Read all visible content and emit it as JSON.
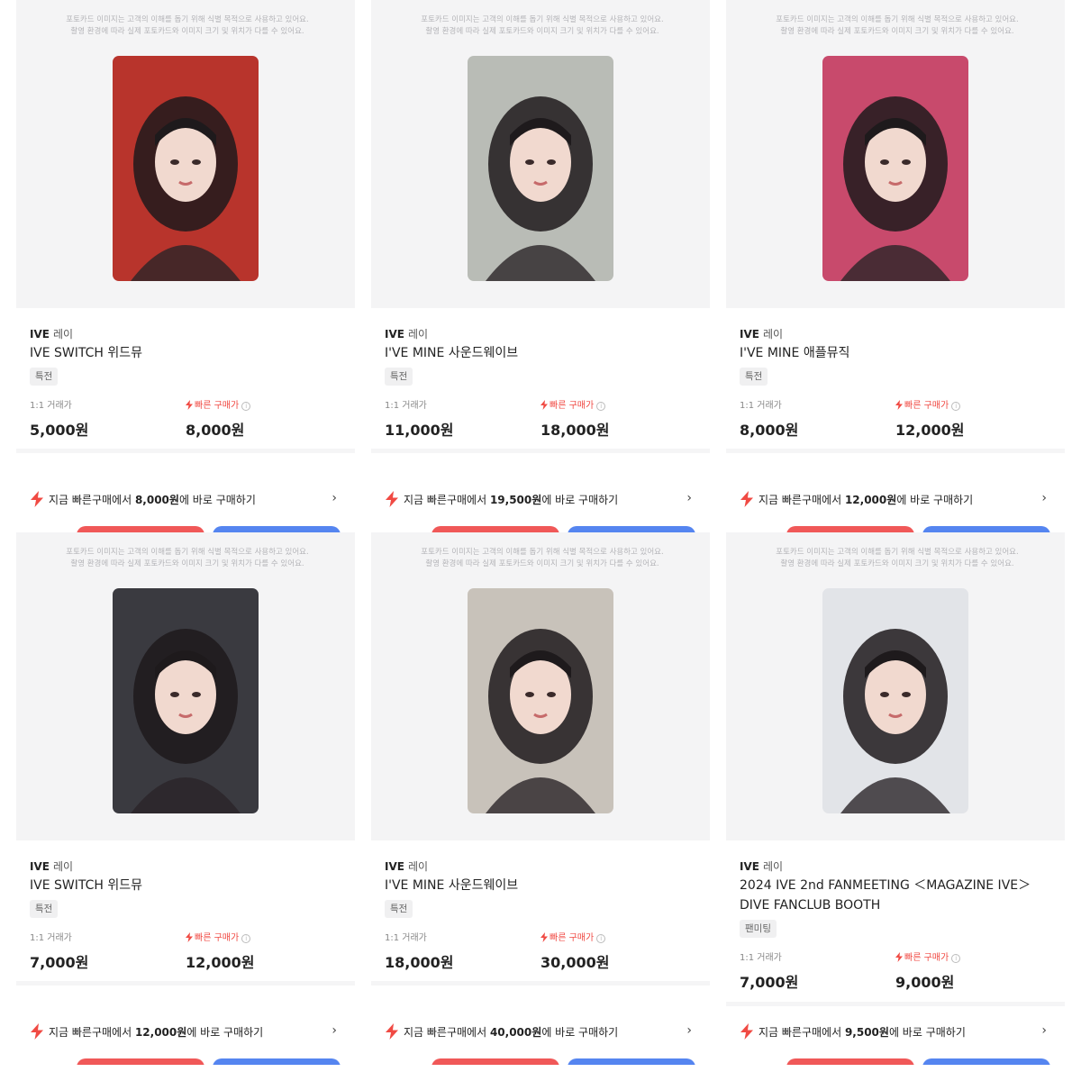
{
  "notice_lines": [
    "포토카드 이미지는 고객의 이해를 돕기 위해 식별 목적으로 사용하고 있어요.",
    "촬영 환경에 따라 실제 포토카드와 이미지 크기 및 위치가 다를 수 있어요."
  ],
  "labels": {
    "trade_label": "1:1 거래가",
    "quick_label": "빠른 구매가",
    "info_icon": "info-icon",
    "bolt_icon": "lightning-icon",
    "chevron_icon": "chevron-right-icon",
    "chevron_glyph": "›"
  },
  "colors": {
    "accent_red": "#f04a43",
    "button_red": "#f05858",
    "button_blue": "#5585f0",
    "image_bg": "#f4f4f5"
  },
  "products": [
    {
      "group": "IVE",
      "member": "레이",
      "album": "IVE SWITCH 위드뮤",
      "tag": "특전",
      "trade_price": "5,000원",
      "quick_price": "8,000원",
      "cta_prefix": "지금 빠른구매에서 ",
      "cta_price": "8,000원",
      "cta_suffix": "에 바로 구매하기",
      "photo_bg": "#b8342c"
    },
    {
      "group": "IVE",
      "member": "레이",
      "album": "I'VE MINE 사운드웨이브",
      "tag": "특전",
      "trade_price": "11,000원",
      "quick_price": "18,000원",
      "cta_prefix": "지금 빠른구매에서 ",
      "cta_price": "19,500원",
      "cta_suffix": "에 바로 구매하기",
      "photo_bg": "#b9bcb6"
    },
    {
      "group": "IVE",
      "member": "레이",
      "album": "I'VE MINE 애플뮤직",
      "tag": "특전",
      "trade_price": "8,000원",
      "quick_price": "12,000원",
      "cta_prefix": "지금 빠른구매에서 ",
      "cta_price": "12,000원",
      "cta_suffix": "에 바로 구매하기",
      "photo_bg": "#c84a6c"
    },
    {
      "group": "IVE",
      "member": "레이",
      "album": "IVE SWITCH 위드뮤",
      "tag": "특전",
      "trade_price": "7,000원",
      "quick_price": "12,000원",
      "cta_prefix": "지금 빠른구매에서 ",
      "cta_price": "12,000원",
      "cta_suffix": "에 바로 구매하기",
      "photo_bg": "#3a3a40"
    },
    {
      "group": "IVE",
      "member": "레이",
      "album": "I'VE MINE 사운드웨이브",
      "tag": "특전",
      "trade_price": "18,000원",
      "quick_price": "30,000원",
      "cta_prefix": "지금 빠른구매에서 ",
      "cta_price": "40,000원",
      "cta_suffix": "에 바로 구매하기",
      "photo_bg": "#c8c2ba"
    },
    {
      "group": "IVE",
      "member": "레이",
      "album": "2024 IVE 2nd FANMEETING ＜MAGAZINE IVE＞DIVE FANCLUB BOOTH",
      "tag": "팬미팅",
      "trade_price": "7,000원",
      "quick_price": "9,000원",
      "cta_prefix": "지금 빠른구매에서 ",
      "cta_price": "9,500원",
      "cta_suffix": "에 바로 구매하기",
      "photo_bg": "#e2e4e8"
    }
  ]
}
